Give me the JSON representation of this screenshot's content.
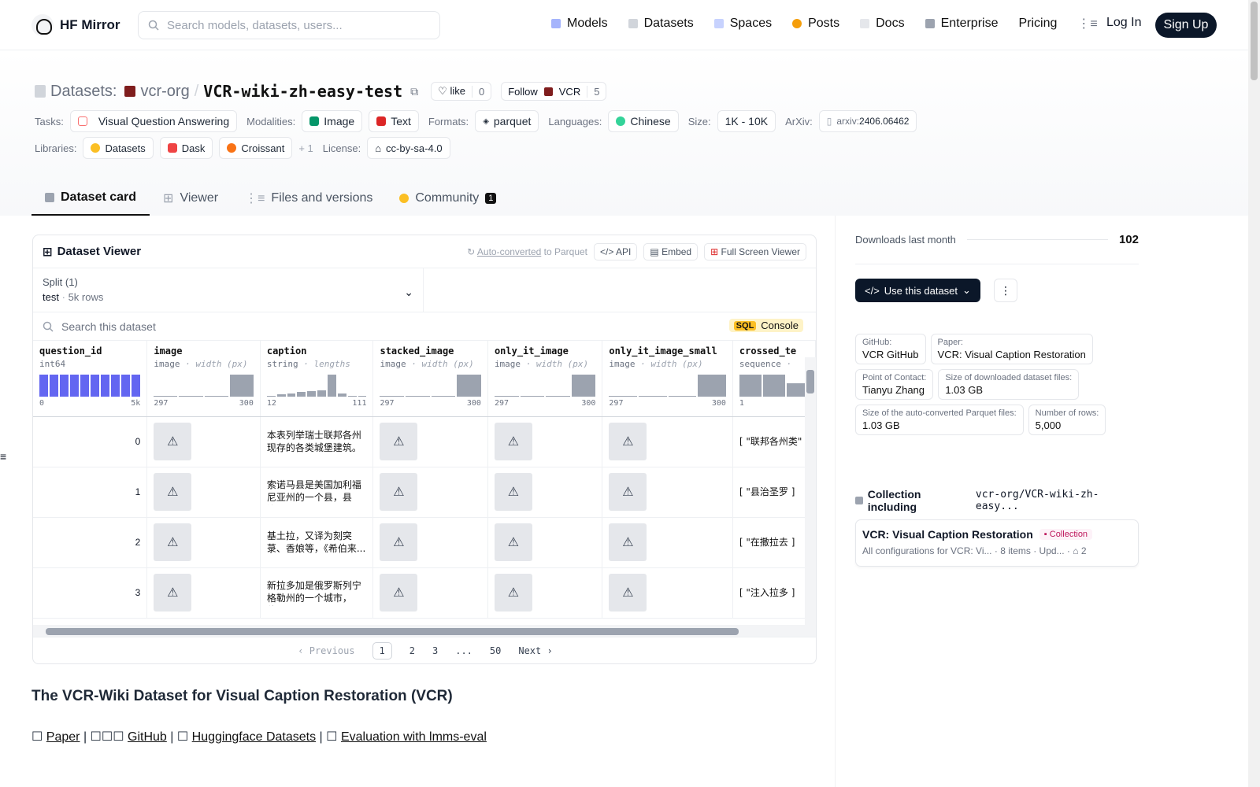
{
  "nav": {
    "brand": "HF Mirror",
    "search_placeholder": "Search models, datasets, users...",
    "links": [
      "Models",
      "Datasets",
      "Spaces",
      "Posts",
      "Docs",
      "Enterprise",
      "Pricing"
    ],
    "login": "Log In",
    "signup": "Sign Up"
  },
  "header": {
    "crumb_label": "Datasets:",
    "org": "vcr-org",
    "sep": "/",
    "name": "VCR-wiki-zh-easy-test",
    "like": "like",
    "like_count": "0",
    "follow": "Follow",
    "follow_org": "VCR",
    "follow_count": "5",
    "tasks_label": "Tasks:",
    "task": "Visual Question Answering",
    "modalities_label": "Modalities:",
    "modality1": "Image",
    "modality2": "Text",
    "formats_label": "Formats:",
    "format": "parquet",
    "languages_label": "Languages:",
    "language": "Chinese",
    "size_label": "Size:",
    "size": "1K - 10K",
    "arxiv_label": "ArXiv:",
    "arxiv_prefix": "arxiv:",
    "arxiv": "2406.06462",
    "libraries_label": "Libraries:",
    "lib1": "Datasets",
    "lib2": "Dask",
    "lib3": "Croissant",
    "lib_more": "+ 1",
    "license_label": "License:",
    "license": "cc-by-sa-4.0"
  },
  "tabs": [
    "Dataset card",
    "Viewer",
    "Files and versions",
    "Community"
  ],
  "community_count": "1",
  "viewer": {
    "title": "Dataset Viewer",
    "auto_converted": "Auto-converted",
    "to_parquet": "to Parquet",
    "api": "API",
    "embed": "Embed",
    "fullscreen": "Full Screen Viewer",
    "split_label": "Split (1)",
    "split_name": "test",
    "split_rows": "5k rows",
    "search_placeholder": "Search this dataset",
    "sql": "SQL",
    "console": "Console",
    "columns": [
      {
        "name": "question_id",
        "type": "int64",
        "sub": "",
        "min": "0",
        "max": "5k"
      },
      {
        "name": "image",
        "type": "image",
        "sub": "· width (px)",
        "min": "297",
        "max": "300"
      },
      {
        "name": "caption",
        "type": "string",
        "sub": "· lengths",
        "min": "12",
        "max": "111"
      },
      {
        "name": "stacked_image",
        "type": "image",
        "sub": "· width (px)",
        "min": "297",
        "max": "300"
      },
      {
        "name": "only_it_image",
        "type": "image",
        "sub": "· width (px)",
        "min": "297",
        "max": "300"
      },
      {
        "name": "only_it_image_small",
        "type": "image",
        "sub": "· width (px)",
        "min": "297",
        "max": "300"
      },
      {
        "name": "crossed_te",
        "type": "sequence",
        "sub": "·",
        "min": "1",
        "max": ""
      }
    ],
    "rows": [
      {
        "id": "0",
        "caption": "本表列举瑞士联邦各州现存的各类城堡建筑。",
        "crossed": "[ \"联邦各州类\" ]"
      },
      {
        "id": "1",
        "caption": "索诺马县是美国加利福尼亚州的一个县，县治...",
        "crossed": "[ \"县治圣罗 ]"
      },
      {
        "id": "2",
        "caption": "基土拉，又译为刻突菉、香娘等，《希伯来...",
        "crossed": "[ \"在撒拉去 ]"
      },
      {
        "id": "3",
        "caption": "新拉多加是俄罗斯列宁格勒州的一个城市，位...",
        "crossed": "[ \"注入拉多 ]"
      }
    ],
    "pager": {
      "prev": "Previous",
      "pages": [
        "1",
        "2",
        "3",
        "...",
        "50"
      ],
      "next": "Next"
    }
  },
  "doc": {
    "heading": "The VCR-Wiki Dataset for Visual Caption Restoration (VCR)",
    "links": [
      "Paper",
      "GitHub",
      "Huggingface Datasets",
      "Evaluation with lmms-eval"
    ]
  },
  "side": {
    "downloads_label": "Downloads last month",
    "downloads": "102",
    "use_btn": "Use this dataset",
    "cards": [
      {
        "k": "GitHub:",
        "v": "VCR GitHub"
      },
      {
        "k": "Paper:",
        "v": "VCR: Visual Caption Restoration"
      },
      {
        "k": "Point of Contact:",
        "v": "Tianyu Zhang"
      },
      {
        "k": "Size of downloaded dataset files:",
        "v": "1.03 GB"
      },
      {
        "k": "Size of the auto-converted Parquet files:",
        "v": "1.03 GB"
      },
      {
        "k": "Number of rows:",
        "v": "5,000"
      }
    ],
    "coll_label": "Collection including",
    "coll_repo": "vcr-org/VCR-wiki-zh-easy...",
    "coll_title": "VCR: Visual Caption Restoration",
    "coll_tag": "Collection",
    "coll_sub": "All configurations for VCR: Vi...",
    "coll_items": "8 items",
    "coll_upd": "Upd...",
    "coll_likes": "2"
  }
}
